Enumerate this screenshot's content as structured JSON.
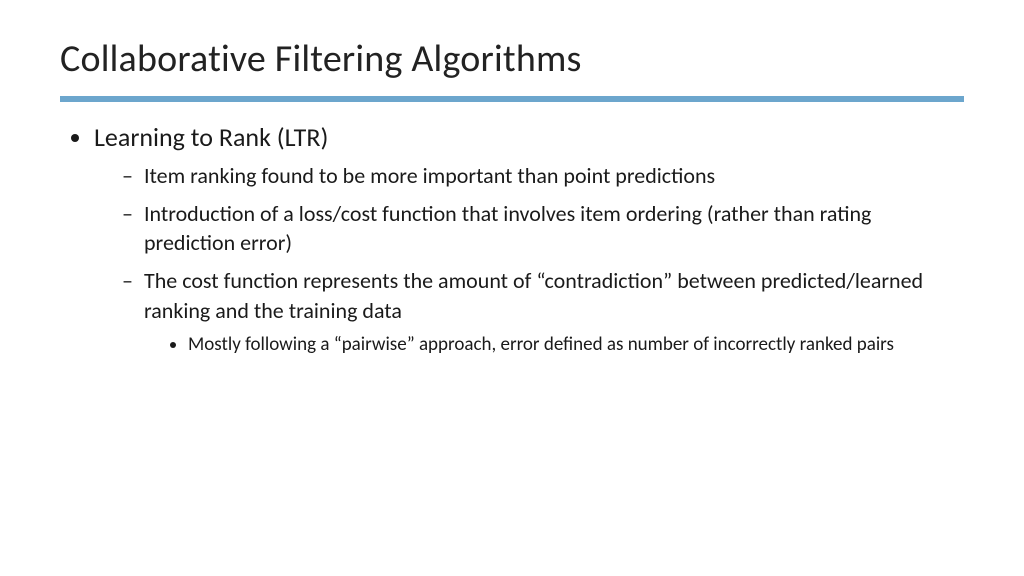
{
  "slide": {
    "title": "Collaborative Filtering Algorithms",
    "accent_color": "#6ca6cd",
    "bullets": [
      {
        "text": "Learning to Rank (LTR)",
        "children": [
          {
            "text": "Item ranking found to be more important than point predictions"
          },
          {
            "text": "Introduction of a loss/cost function that involves item ordering (rather than rating prediction error)"
          },
          {
            "text": "The cost function represents the amount of “contradiction” between predicted/learned ranking and the training data",
            "children": [
              {
                "text": "Mostly following a “pairwise” approach, error defined as number of incorrectly ranked pairs"
              }
            ]
          }
        ]
      }
    ]
  }
}
